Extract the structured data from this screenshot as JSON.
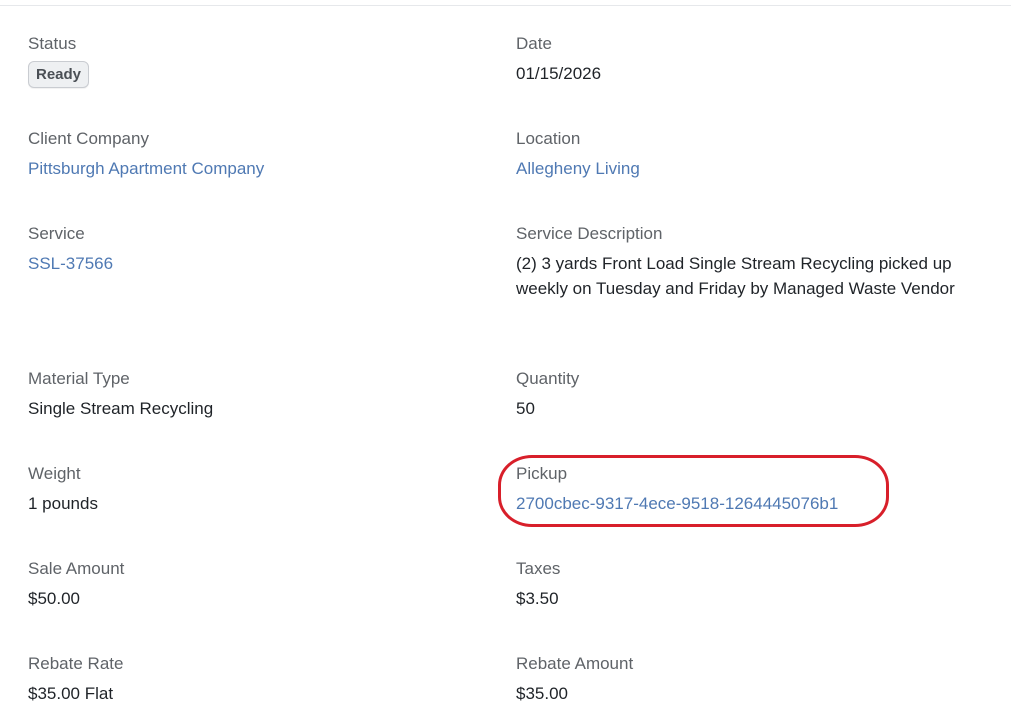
{
  "fields": {
    "status": {
      "label": "Status",
      "value": "Ready"
    },
    "date": {
      "label": "Date",
      "value": "01/15/2026"
    },
    "client_company": {
      "label": "Client Company",
      "value": "Pittsburgh Apartment Company"
    },
    "location": {
      "label": "Location",
      "value": "Allegheny Living"
    },
    "service": {
      "label": "Service",
      "value": "SSL-37566"
    },
    "service_description": {
      "label": "Service Description",
      "value": "(2) 3 yards Front Load Single Stream Recycling picked up weekly on Tuesday and Friday by Managed Waste Vendor"
    },
    "material_type": {
      "label": "Material Type",
      "value": "Single Stream Recycling"
    },
    "quantity": {
      "label": "Quantity",
      "value": "50"
    },
    "weight": {
      "label": "Weight",
      "value": "1 pounds"
    },
    "pickup": {
      "label": "Pickup",
      "value": "2700cbec-9317-4ece-9518-1264445076b1"
    },
    "sale_amount": {
      "label": "Sale Amount",
      "value": "$50.00"
    },
    "taxes": {
      "label": "Taxes",
      "value": "$3.50"
    },
    "rebate_rate": {
      "label": "Rebate Rate",
      "value": "$35.00 Flat"
    },
    "rebate_amount": {
      "label": "Rebate Amount",
      "value": "$35.00"
    }
  },
  "colors": {
    "link": "#4f79b3",
    "label": "#5f6368",
    "highlight": "#d81f2a",
    "badge_bg": "#eef0f2"
  }
}
